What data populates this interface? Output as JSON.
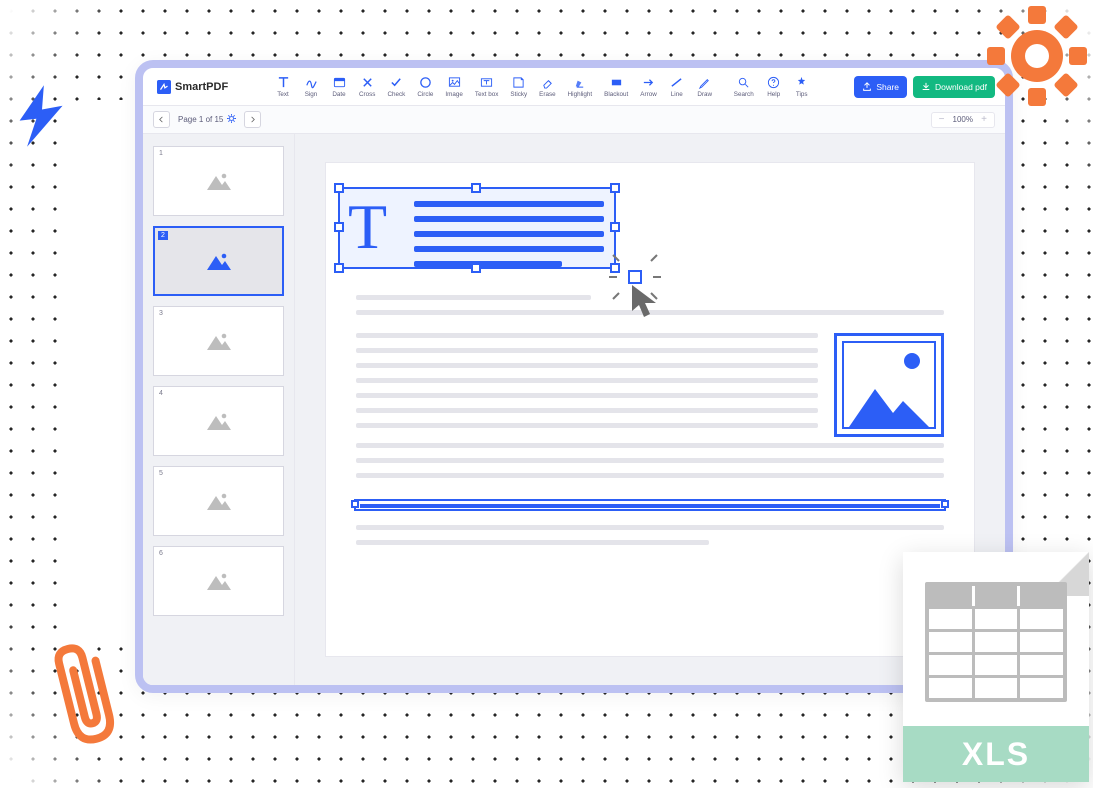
{
  "brand": "SmartPDF",
  "tools": [
    {
      "id": "text",
      "label": "Text"
    },
    {
      "id": "sign",
      "label": "Sign"
    },
    {
      "id": "date",
      "label": "Date"
    },
    {
      "id": "cross",
      "label": "Cross"
    },
    {
      "id": "check",
      "label": "Check"
    },
    {
      "id": "circle",
      "label": "Circle"
    },
    {
      "id": "image",
      "label": "Image"
    },
    {
      "id": "textbox",
      "label": "Text box"
    },
    {
      "id": "sticky",
      "label": "Sticky"
    },
    {
      "id": "erase",
      "label": "Erase"
    },
    {
      "id": "highlight",
      "label": "Highlight"
    },
    {
      "id": "blackout",
      "label": "Blackout"
    },
    {
      "id": "arrow",
      "label": "Arrow"
    },
    {
      "id": "line",
      "label": "Line"
    },
    {
      "id": "draw",
      "label": "Draw"
    }
  ],
  "utilTools": [
    {
      "id": "search",
      "label": "Search"
    },
    {
      "id": "help",
      "label": "Help"
    },
    {
      "id": "tips",
      "label": "Tips"
    }
  ],
  "buttons": {
    "share": "Share",
    "download": "Download pdf"
  },
  "pageInfo": "Page 1 of 15",
  "zoom": "100%",
  "thumbCount": 6,
  "selectedThumb": 2,
  "xlsLabel": "XLS",
  "bigLetter": "T"
}
